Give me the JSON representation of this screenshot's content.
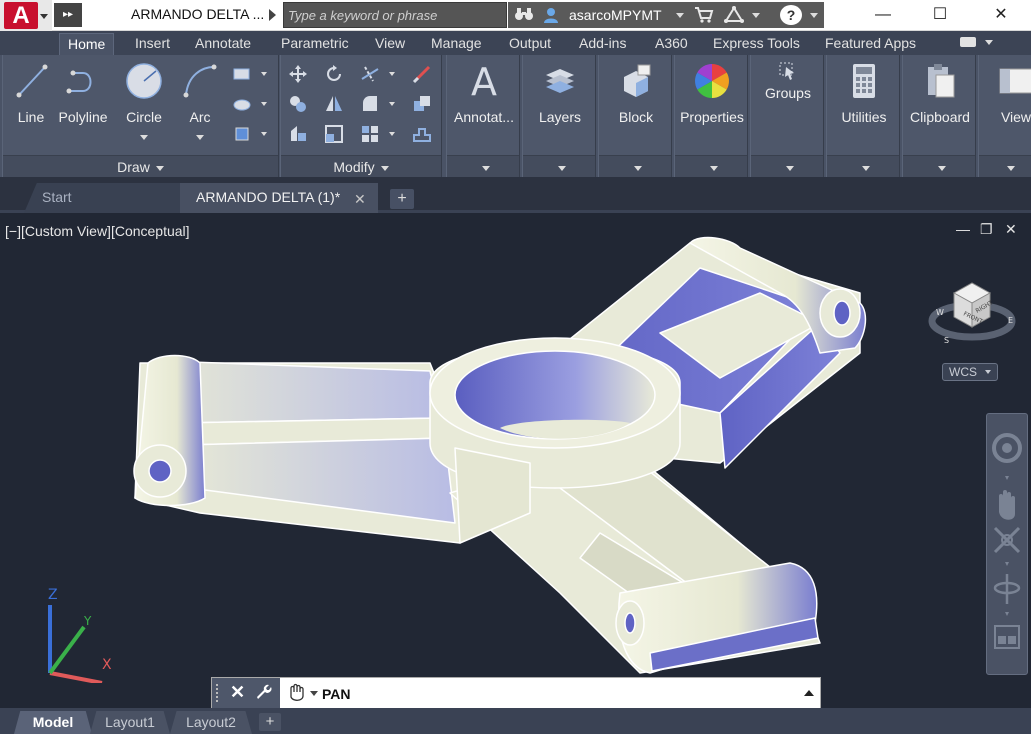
{
  "title_bar": {
    "app_logo": "A",
    "document_title": "ARMANDO DELTA ...",
    "search_placeholder": "Type a keyword or phrase",
    "user_name": "asarcoMPYMT",
    "help_label": "?",
    "icons": [
      "autocad-logo-icon",
      "binoculars-icon",
      "user-icon",
      "cart-icon",
      "a360-icon",
      "help-icon",
      "minimize-icon",
      "maximize-icon",
      "close-icon"
    ]
  },
  "ribbon_tabs": [
    "Home",
    "Insert",
    "Annotate",
    "Parametric",
    "View",
    "Manage",
    "Output",
    "Add-ins",
    "A360",
    "Express Tools",
    "Featured Apps"
  ],
  "active_tab": "Home",
  "ribbon": {
    "draw": {
      "title": "Draw",
      "buttons": [
        {
          "label": "Line",
          "icon": "line-icon"
        },
        {
          "label": "Polyline",
          "icon": "polyline-icon"
        },
        {
          "label": "Circle",
          "icon": "circle-icon"
        },
        {
          "label": "Arc",
          "icon": "arc-icon"
        }
      ]
    },
    "modify": {
      "title": "Modify"
    },
    "annotation": {
      "label": "Annotat...",
      "icon": "annotation-icon"
    },
    "layers": {
      "label": "Layers",
      "icon": "layers-icon"
    },
    "block": {
      "label": "Block",
      "icon": "block-icon"
    },
    "properties": {
      "label": "Properties",
      "icon": "color-wheel-icon"
    },
    "groups": {
      "label": "Groups",
      "icon": "groups-icon"
    },
    "utilities": {
      "label": "Utilities",
      "icon": "calculator-icon"
    },
    "clipboard": {
      "label": "Clipboard",
      "icon": "clipboard-icon"
    },
    "view": {
      "label": "View",
      "icon": "view-icon"
    }
  },
  "doc_tabs": {
    "start": "Start",
    "active": "ARMANDO DELTA (1)*",
    "close": "✕",
    "add": "+"
  },
  "viewport": {
    "label": "[−][Custom View][Conceptual]",
    "wcs": "WCS",
    "viewcube": {
      "front": "FRONT",
      "right": "RIGHT",
      "north": "N",
      "east": "E",
      "south": "S",
      "west": "W"
    },
    "ucs": {
      "x": "X",
      "y": "Y",
      "z": "Z"
    },
    "colors": {
      "background": "#212734",
      "model_light": "#e8ead8",
      "model_shadow": "#6b6fc8",
      "model_edge": "#ffffff"
    }
  },
  "command_line": {
    "value": "PAN",
    "close": "✕",
    "customize": "🔧"
  },
  "layout_tabs": [
    "Model",
    "Layout1",
    "Layout2"
  ],
  "active_layout": "Model",
  "layout_add": "+"
}
